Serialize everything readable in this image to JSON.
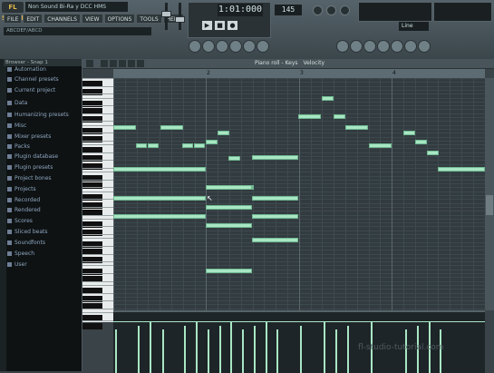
{
  "app": {
    "logo": "FL STUDIO",
    "title": "Non Sound Bi-Ra y DCC HMS",
    "hint": "ABCDEF/ABCD",
    "pattern": "Line"
  },
  "menu": [
    "FILE",
    "EDIT",
    "CHANNELS",
    "VIEW",
    "OPTIONS",
    "TOOLS",
    "HELP"
  ],
  "transport": {
    "time": "1:01:000",
    "tempo": "145",
    "play": "▶",
    "stop": "■",
    "record": "●"
  },
  "browser": {
    "header": "Browser - Snap 1",
    "items": [
      "Automation",
      "Channel presets",
      "Current project",
      "Data",
      "Humanizing presets",
      "Misc",
      "Mixer presets",
      "Packs",
      "Plugin database",
      "Plugin presets",
      "Project bones",
      "Projects",
      "Recorded",
      "Rendered",
      "Scores",
      "Sliced beats",
      "Soundfonts",
      "Speech",
      "User"
    ]
  },
  "piano_roll": {
    "title": "Piano roll - Keys",
    "target": "Velocity",
    "bar_numbers": [
      "2",
      "3",
      "4"
    ]
  },
  "watermark": "fl-studio-tutorial.com",
  "colors": {
    "note": "#a8e6c4",
    "grid": "#323b40",
    "browser_text": "#8ea7c0",
    "background": "#3a4347"
  },
  "notes": [
    {
      "start": 0.0,
      "dur": 0.25,
      "pitch": 60
    },
    {
      "start": 0.25,
      "dur": 0.0,
      "pitch": 0
    },
    {
      "start": 0.5,
      "dur": 0.25,
      "pitch": 58
    },
    {
      "start": 0.75,
      "dur": 0.25,
      "pitch": 58
    },
    {
      "start": 1.0,
      "dur": 0.5,
      "pitch": 60
    },
    {
      "start": 1.5,
      "dur": 0.25,
      "pitch": 58
    },
    {
      "start": 1.75,
      "dur": 0.25,
      "pitch": 58
    },
    {
      "start": 2.0,
      "dur": 0.25,
      "pitch": 57
    }
  ]
}
